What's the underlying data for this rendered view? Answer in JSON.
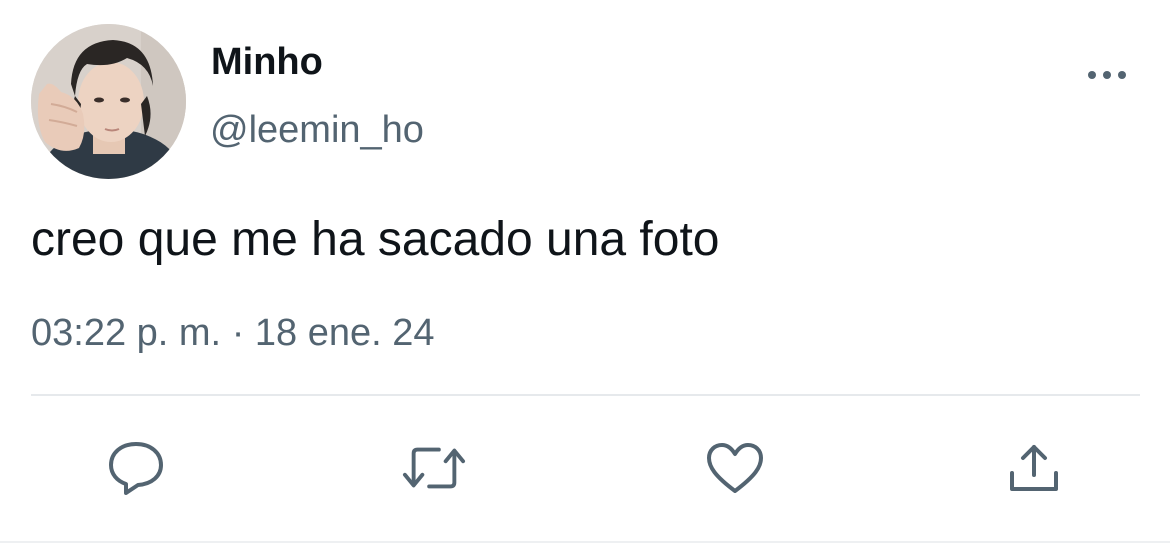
{
  "tweet": {
    "author": {
      "display_name": "Minho",
      "handle": "@leemin_ho"
    },
    "text": "creo que me ha sacado una foto",
    "time": "03:22 p. m.",
    "separator": "·",
    "date": "18 ene. 24"
  },
  "actions": [
    {
      "name": "reply",
      "icon": "comment-icon"
    },
    {
      "name": "retweet",
      "icon": "retweet-icon"
    },
    {
      "name": "like",
      "icon": "heart-icon"
    },
    {
      "name": "share",
      "icon": "share-icon"
    }
  ],
  "colors": {
    "text_primary": "#0f1419",
    "text_secondary": "#536471",
    "icon": "#536471",
    "divider": "#e6e9ec"
  }
}
